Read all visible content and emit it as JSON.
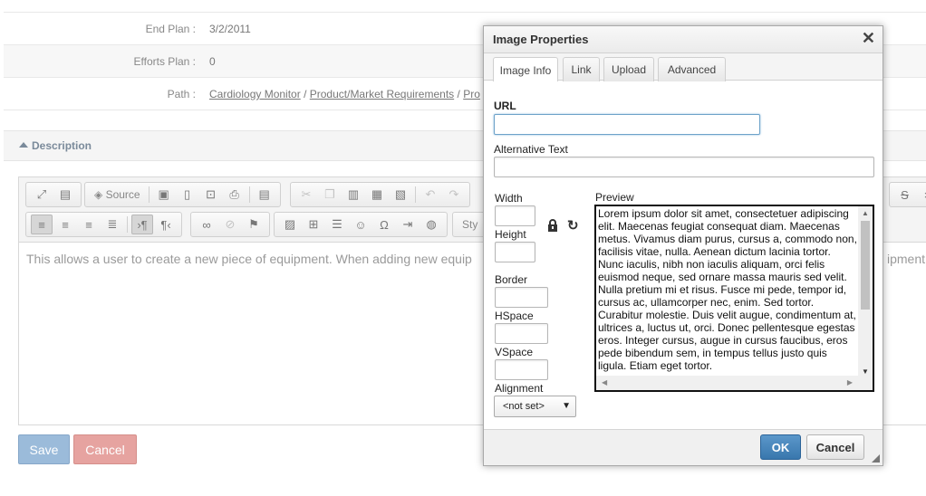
{
  "properties": {
    "end_plan": {
      "label": "End Plan :",
      "value": "3/2/2011"
    },
    "efforts_plan": {
      "label": "Efforts Plan :",
      "value": "0"
    },
    "path": {
      "label": "Path :",
      "links": [
        "Cardiology Monitor",
        "Product/Market Requirements",
        "Pro"
      ],
      "separator": "/"
    }
  },
  "description": {
    "title": "Description",
    "toolbar": {
      "source_label": "Source",
      "styles_label": "Sty"
    },
    "content_left": "This allows a user to create a new piece of equipment. When adding new equip",
    "content_right": "ipment"
  },
  "form_buttons": {
    "save": "Save",
    "cancel": "Cancel"
  },
  "dialog": {
    "title": "Image Properties",
    "close_glyph": "✕",
    "tabs": [
      "Image Info",
      "Link",
      "Upload",
      "Advanced"
    ],
    "active_tab": "Image Info",
    "fields": {
      "url_label": "URL",
      "url_value": "",
      "alt_label": "Alternative Text",
      "alt_value": "",
      "width_label": "Width",
      "height_label": "Height",
      "border_label": "Border",
      "hspace_label": "HSpace",
      "vspace_label": "VSpace",
      "alignment_label": "Alignment",
      "alignment_value": "<not set>",
      "preview_label": "Preview"
    },
    "preview_text": "Lorem ipsum dolor sit amet, consectetuer adipiscing elit. Maecenas feugiat consequat diam. Maecenas metus. Vivamus diam purus, cursus a, commodo non, facilisis vitae, nulla. Aenean dictum lacinia tortor. Nunc iaculis, nibh non iaculis aliquam, orci felis euismod neque, sed ornare massa mauris sed velit. Nulla pretium mi et risus. Fusce mi pede, tempor id, cursus ac, ullamcorper nec, enim. Sed tortor. Curabitur molestie. Duis velit augue, condimentum at, ultrices a, luctus ut, orci. Donec pellentesque egestas eros. Integer cursus, augue in cursus faucibus, eros pede bibendum sem, in tempus tellus justo quis ligula. Etiam eget tortor.",
    "ok_label": "OK",
    "cancel_label": "Cancel"
  },
  "colors": {
    "ok_button": "#3977ad",
    "save_button": "#9bbbda",
    "cancel_button": "#e6a3a0",
    "focus_border": "#6ea3c9"
  }
}
